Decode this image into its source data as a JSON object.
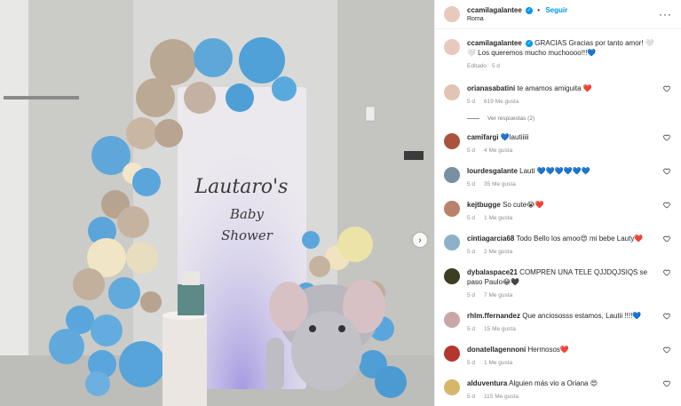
{
  "post": {
    "username": "ccamilagalantee",
    "location": "Roma",
    "follow_label": "Seguir",
    "dot": "•",
    "caption": "GRACIAS Gracias por tanto amor! 🤍🤍 Los queremos mucho muchoooo!!!💙",
    "caption_meta": "Editado · 5 d"
  },
  "photo": {
    "sign_line1": "Lautaro's",
    "sign_line2": "Baby",
    "sign_line3": "Shower"
  },
  "comments": [
    {
      "user": "orianasabatini",
      "text": "te amamos amiguita ❤️",
      "time": "5 d",
      "likes": "619 Me gusta",
      "color": "#e2c4b4",
      "replies": "Ver respuestas (2)"
    },
    {
      "user": "camifargi",
      "text": "💙lautiiiii",
      "time": "5 d",
      "likes": "4 Me gusta",
      "color": "#a9543c"
    },
    {
      "user": "lourdesgalante",
      "text": "Lauti 💙💙💙💙💙💙",
      "time": "5 d",
      "likes": "35 Me gusta",
      "color": "#7a8fa1"
    },
    {
      "user": "kejtbugge",
      "text": "So cute😭❤️",
      "time": "5 d",
      "likes": "1 Me gusta",
      "color": "#b9826a"
    },
    {
      "user": "cintiagarcia68",
      "text": "Todo Bello los amoo😍 mi bebe Lauty❤️",
      "time": "5 d",
      "likes": "2 Me gusta",
      "color": "#8fb0c9"
    },
    {
      "user": "dybalaspace21",
      "text": "COMPREN UNA TELE QJJDQJSIQS se paso Paulo😂🖤",
      "time": "5 d",
      "likes": "7 Me gusta",
      "color": "#3d3d22"
    },
    {
      "user": "rhlm.ffernandez",
      "text": "Que anciososss estamos, Lautii !!!!💙",
      "time": "5 d",
      "likes": "15 Me gusta",
      "color": "#c9a6a8"
    },
    {
      "user": "donatellagennoni",
      "text": "Hermosos❤️",
      "time": "5 d",
      "likes": "1 Me gusta",
      "color": "#b3372e"
    },
    {
      "user": "alduventura",
      "text": "Alguien más vio a Oriana 😍",
      "time": "5 d",
      "likes": "115 Me gusta",
      "color": "#d6b66a"
    }
  ],
  "colors": {
    "accent": "#0095f6",
    "heart": "#262626"
  }
}
